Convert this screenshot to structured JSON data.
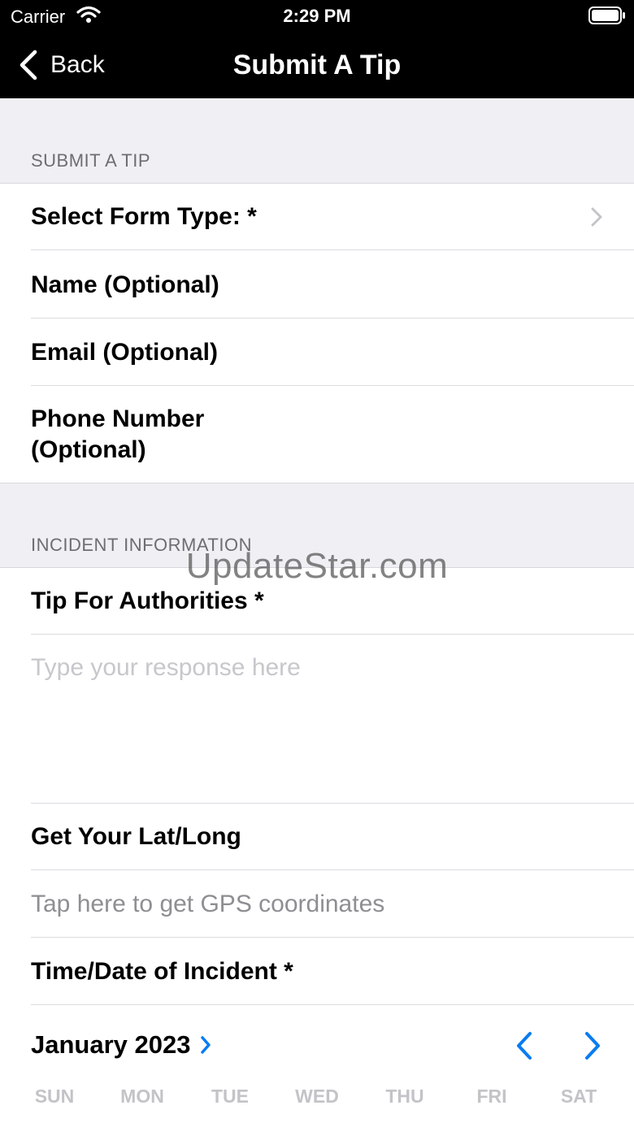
{
  "status_bar": {
    "carrier": "Carrier",
    "time": "2:29 PM"
  },
  "nav": {
    "back_label": "Back",
    "title": "Submit A Tip"
  },
  "sections": {
    "submit": {
      "header": "SUBMIT A TIP",
      "form_type_label": "Select Form Type: *",
      "name_label": "Name (Optional)",
      "email_label": "Email (Optional)",
      "phone_label_line1": "Phone Number",
      "phone_label_line2": "(Optional)"
    },
    "incident": {
      "header": "INCIDENT INFORMATION",
      "tip_label": "Tip For Authorities *",
      "tip_placeholder": "Type your response here",
      "latlong_label": "Get Your Lat/Long",
      "gps_button": "Tap here to get GPS coordinates",
      "datetime_label": "Time/Date of Incident *"
    }
  },
  "calendar": {
    "month": "January 2023",
    "weekdays": [
      "SUN",
      "MON",
      "TUE",
      "WED",
      "THU",
      "FRI",
      "SAT"
    ]
  },
  "watermark": "UpdateStar.com",
  "colors": {
    "accent": "#0a7cf0",
    "header_bg": "#efeff4",
    "nav_bg": "#000000"
  },
  "icons": [
    "wifi-icon",
    "battery-icon",
    "back-chevron-icon",
    "chevron-right-icon",
    "month-chevron-icon",
    "prev-month-icon",
    "next-month-icon"
  ]
}
